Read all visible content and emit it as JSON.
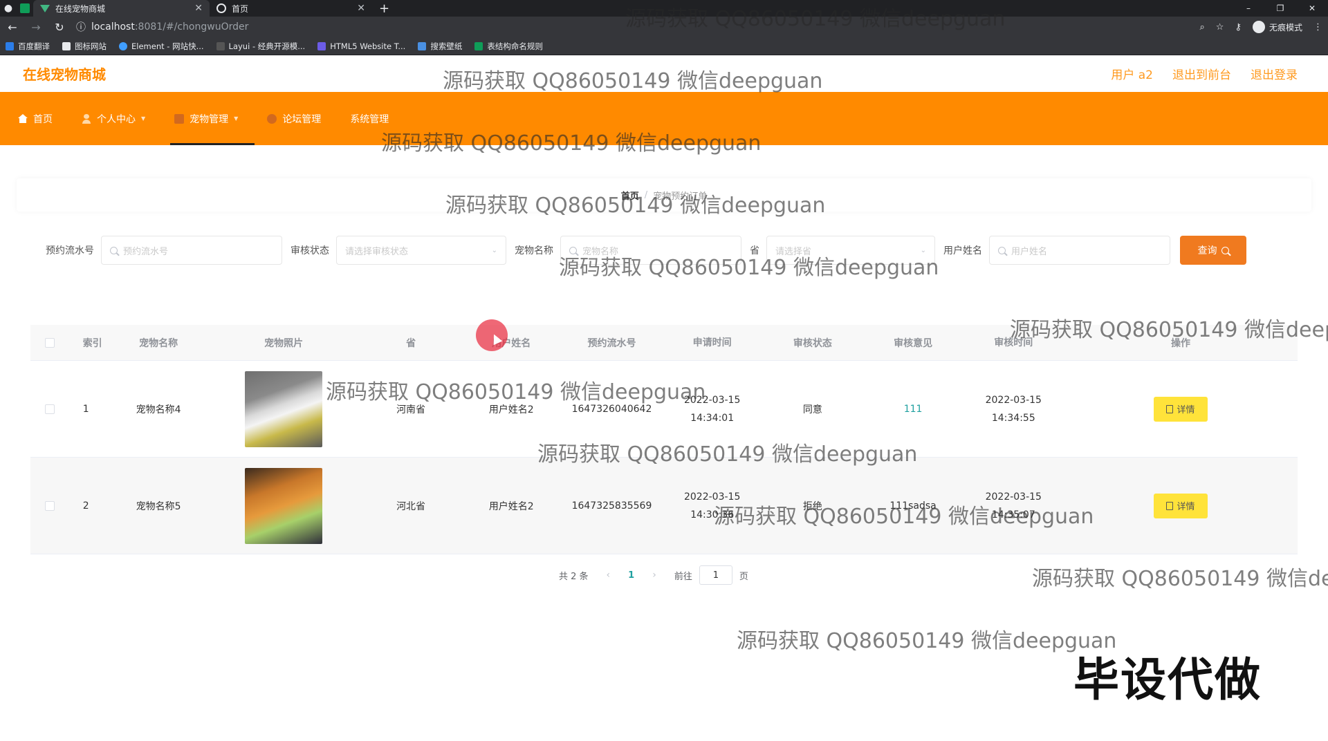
{
  "browser": {
    "tabs": [
      {
        "title": "在线宠物商城",
        "active": true
      },
      {
        "title": "首页",
        "active": false
      }
    ],
    "url_host": "localhost",
    "url_path": ":8081/#/chongwuOrder",
    "incognito_label": "无痕模式",
    "bookmarks": [
      "百度翻译",
      "图标网站",
      "Element - 网站快...",
      "Layui - 经典开源模...",
      "HTML5 Website T...",
      "搜索壁纸",
      "表结构命名规则"
    ]
  },
  "header": {
    "logo": "在线宠物商城",
    "links": [
      "用户 a2",
      "退出到前台",
      "退出登录"
    ]
  },
  "nav": {
    "items": [
      {
        "label": "首页",
        "icon": "home-icon",
        "active": false
      },
      {
        "label": "个人中心",
        "icon": "user-icon",
        "active": false
      },
      {
        "label": "宠物管理",
        "icon": "pet-icon",
        "active": true
      },
      {
        "label": "论坛管理",
        "icon": "forum-icon",
        "active": false
      },
      {
        "label": "系统管理",
        "icon": "",
        "active": false
      }
    ]
  },
  "breadcrumb": {
    "home": "首页",
    "separator": "/",
    "current": "宠物预约订单"
  },
  "filters": {
    "order_no_label": "预约流水号",
    "order_no_placeholder": "预约流水号",
    "status_label": "审核状态",
    "status_placeholder": "请选择审核状态",
    "pet_name_label": "宠物名称",
    "pet_name_placeholder": "宠物名称",
    "province_label": "省",
    "province_placeholder": "请选择省",
    "user_name_label": "用户姓名",
    "user_name_placeholder": "用户姓名",
    "query_button": "查询"
  },
  "table": {
    "columns": [
      "索引",
      "宠物名称",
      "宠物照片",
      "省",
      "用户姓名",
      "预约流水号",
      "申请时间",
      "审核状态",
      "审核意见",
      "审核时间",
      "操作"
    ],
    "rows": [
      {
        "index": "1",
        "pet_name": "宠物名称4",
        "province": "河南省",
        "user_name": "用户姓名2",
        "order_no": "1647326040642",
        "apply_time": "2022-03-15 14:34:01",
        "status": "同意",
        "opinion": "111",
        "review_time": "2022-03-15 14:34:55",
        "action": "详情"
      },
      {
        "index": "2",
        "pet_name": "宠物名称5",
        "province": "河北省",
        "user_name": "用户姓名2",
        "order_no": "1647325835569",
        "apply_time": "2022-03-15 14:30:36",
        "status": "拒绝",
        "opinion": "111sadsa",
        "review_time": "2022-03-15 14:35:07",
        "action": "详情"
      }
    ]
  },
  "pagination": {
    "total": "共 2 条",
    "current_page": "1",
    "goto_prefix": "前往",
    "goto_value": "1",
    "goto_suffix": "页"
  },
  "overlays": {
    "watermark": "源码获取 QQ86050149 微信deepguan",
    "stamp": "毕设代做"
  },
  "colors": {
    "brand_orange": "#ff8a00",
    "query_button": "#f07a1f",
    "detail_button": "#ffe33a"
  }
}
